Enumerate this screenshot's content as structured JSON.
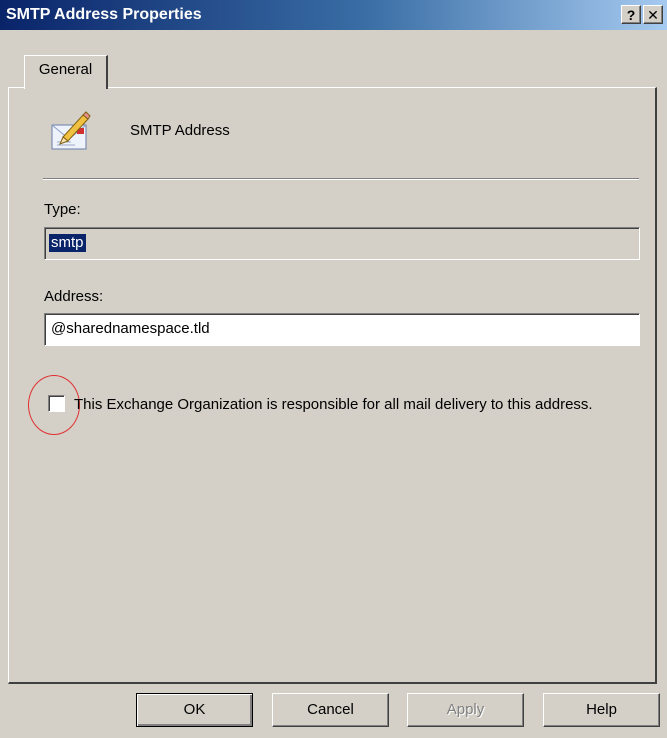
{
  "window": {
    "title": "SMTP Address Properties",
    "help_glyph": "?",
    "close_glyph": "✕"
  },
  "tabs": [
    {
      "label": "General",
      "selected": true
    }
  ],
  "header": {
    "icon": "envelope-pencil-icon",
    "label": "SMTP Address"
  },
  "fields": {
    "type": {
      "label": "Type:",
      "value": "smtp",
      "selected_text": true,
      "readonly": true
    },
    "address": {
      "label": "Address:",
      "value": "@sharednamespace.tld"
    }
  },
  "checkbox": {
    "label": "This Exchange Organization is responsible for all mail delivery to this address.",
    "checked": false,
    "highlight_color": "#e03030"
  },
  "buttons": {
    "ok": "OK",
    "cancel": "Cancel",
    "apply": "Apply",
    "help": "Help"
  }
}
